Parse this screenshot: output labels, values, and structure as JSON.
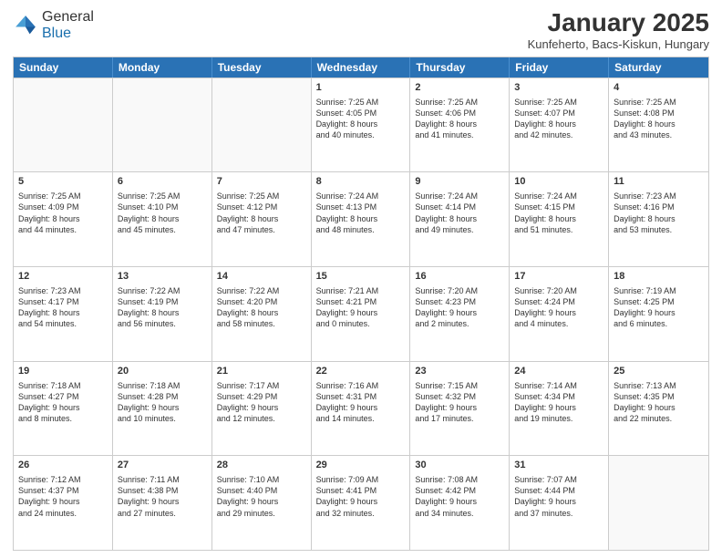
{
  "header": {
    "logo": {
      "general": "General",
      "blue": "Blue"
    },
    "title": "January 2025",
    "subtitle": "Kunfeherto, Bacs-Kiskun, Hungary"
  },
  "weekdays": [
    "Sunday",
    "Monday",
    "Tuesday",
    "Wednesday",
    "Thursday",
    "Friday",
    "Saturday"
  ],
  "rows": [
    [
      {
        "date": "",
        "info": ""
      },
      {
        "date": "",
        "info": ""
      },
      {
        "date": "",
        "info": ""
      },
      {
        "date": "1",
        "info": "Sunrise: 7:25 AM\nSunset: 4:05 PM\nDaylight: 8 hours\nand 40 minutes."
      },
      {
        "date": "2",
        "info": "Sunrise: 7:25 AM\nSunset: 4:06 PM\nDaylight: 8 hours\nand 41 minutes."
      },
      {
        "date": "3",
        "info": "Sunrise: 7:25 AM\nSunset: 4:07 PM\nDaylight: 8 hours\nand 42 minutes."
      },
      {
        "date": "4",
        "info": "Sunrise: 7:25 AM\nSunset: 4:08 PM\nDaylight: 8 hours\nand 43 minutes."
      }
    ],
    [
      {
        "date": "5",
        "info": "Sunrise: 7:25 AM\nSunset: 4:09 PM\nDaylight: 8 hours\nand 44 minutes."
      },
      {
        "date": "6",
        "info": "Sunrise: 7:25 AM\nSunset: 4:10 PM\nDaylight: 8 hours\nand 45 minutes."
      },
      {
        "date": "7",
        "info": "Sunrise: 7:25 AM\nSunset: 4:12 PM\nDaylight: 8 hours\nand 47 minutes."
      },
      {
        "date": "8",
        "info": "Sunrise: 7:24 AM\nSunset: 4:13 PM\nDaylight: 8 hours\nand 48 minutes."
      },
      {
        "date": "9",
        "info": "Sunrise: 7:24 AM\nSunset: 4:14 PM\nDaylight: 8 hours\nand 49 minutes."
      },
      {
        "date": "10",
        "info": "Sunrise: 7:24 AM\nSunset: 4:15 PM\nDaylight: 8 hours\nand 51 minutes."
      },
      {
        "date": "11",
        "info": "Sunrise: 7:23 AM\nSunset: 4:16 PM\nDaylight: 8 hours\nand 53 minutes."
      }
    ],
    [
      {
        "date": "12",
        "info": "Sunrise: 7:23 AM\nSunset: 4:17 PM\nDaylight: 8 hours\nand 54 minutes."
      },
      {
        "date": "13",
        "info": "Sunrise: 7:22 AM\nSunset: 4:19 PM\nDaylight: 8 hours\nand 56 minutes."
      },
      {
        "date": "14",
        "info": "Sunrise: 7:22 AM\nSunset: 4:20 PM\nDaylight: 8 hours\nand 58 minutes."
      },
      {
        "date": "15",
        "info": "Sunrise: 7:21 AM\nSunset: 4:21 PM\nDaylight: 9 hours\nand 0 minutes."
      },
      {
        "date": "16",
        "info": "Sunrise: 7:20 AM\nSunset: 4:23 PM\nDaylight: 9 hours\nand 2 minutes."
      },
      {
        "date": "17",
        "info": "Sunrise: 7:20 AM\nSunset: 4:24 PM\nDaylight: 9 hours\nand 4 minutes."
      },
      {
        "date": "18",
        "info": "Sunrise: 7:19 AM\nSunset: 4:25 PM\nDaylight: 9 hours\nand 6 minutes."
      }
    ],
    [
      {
        "date": "19",
        "info": "Sunrise: 7:18 AM\nSunset: 4:27 PM\nDaylight: 9 hours\nand 8 minutes."
      },
      {
        "date": "20",
        "info": "Sunrise: 7:18 AM\nSunset: 4:28 PM\nDaylight: 9 hours\nand 10 minutes."
      },
      {
        "date": "21",
        "info": "Sunrise: 7:17 AM\nSunset: 4:29 PM\nDaylight: 9 hours\nand 12 minutes."
      },
      {
        "date": "22",
        "info": "Sunrise: 7:16 AM\nSunset: 4:31 PM\nDaylight: 9 hours\nand 14 minutes."
      },
      {
        "date": "23",
        "info": "Sunrise: 7:15 AM\nSunset: 4:32 PM\nDaylight: 9 hours\nand 17 minutes."
      },
      {
        "date": "24",
        "info": "Sunrise: 7:14 AM\nSunset: 4:34 PM\nDaylight: 9 hours\nand 19 minutes."
      },
      {
        "date": "25",
        "info": "Sunrise: 7:13 AM\nSunset: 4:35 PM\nDaylight: 9 hours\nand 22 minutes."
      }
    ],
    [
      {
        "date": "26",
        "info": "Sunrise: 7:12 AM\nSunset: 4:37 PM\nDaylight: 9 hours\nand 24 minutes."
      },
      {
        "date": "27",
        "info": "Sunrise: 7:11 AM\nSunset: 4:38 PM\nDaylight: 9 hours\nand 27 minutes."
      },
      {
        "date": "28",
        "info": "Sunrise: 7:10 AM\nSunset: 4:40 PM\nDaylight: 9 hours\nand 29 minutes."
      },
      {
        "date": "29",
        "info": "Sunrise: 7:09 AM\nSunset: 4:41 PM\nDaylight: 9 hours\nand 32 minutes."
      },
      {
        "date": "30",
        "info": "Sunrise: 7:08 AM\nSunset: 4:42 PM\nDaylight: 9 hours\nand 34 minutes."
      },
      {
        "date": "31",
        "info": "Sunrise: 7:07 AM\nSunset: 4:44 PM\nDaylight: 9 hours\nand 37 minutes."
      },
      {
        "date": "",
        "info": ""
      }
    ]
  ]
}
